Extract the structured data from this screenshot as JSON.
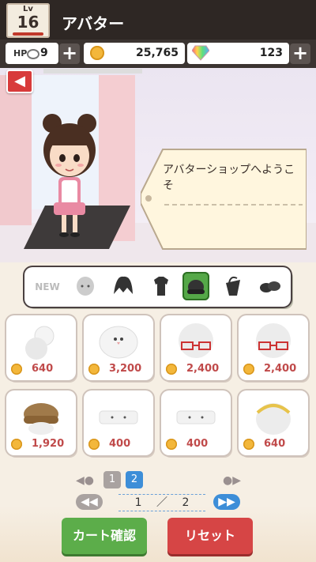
{
  "header": {
    "level_label": "Lv",
    "level": "16",
    "title": "アバター"
  },
  "status": {
    "hp_label": "HP",
    "hp_value": "9",
    "coins": "25,765",
    "gems": "123"
  },
  "stage": {
    "welcome_text": "アバターショップへようこそ"
  },
  "categories": [
    {
      "name": "NEW",
      "selected": false
    },
    {
      "name": "face",
      "selected": false
    },
    {
      "name": "hair",
      "selected": false
    },
    {
      "name": "clothes",
      "selected": false
    },
    {
      "name": "hat",
      "selected": true
    },
    {
      "name": "bag",
      "selected": false
    },
    {
      "name": "shoes",
      "selected": false
    }
  ],
  "items": [
    {
      "price": "640",
      "icon": "chef-hat-icon"
    },
    {
      "price": "3,200",
      "icon": "bird-hat-icon"
    },
    {
      "price": "2,400",
      "icon": "red-glasses-icon"
    },
    {
      "price": "2,400",
      "icon": "red-glasses-icon"
    },
    {
      "price": "1,920",
      "icon": "brown-cap-icon"
    },
    {
      "price": "400",
      "icon": "white-mask-icon"
    },
    {
      "price": "400",
      "icon": "white-mask-icon"
    },
    {
      "price": "640",
      "icon": "gold-headband-icon"
    }
  ],
  "pagination": {
    "page1": "1",
    "page2": "2",
    "current": "1",
    "separator": "／",
    "total": "2"
  },
  "buttons": {
    "cart": "カート確認",
    "reset": "リセット"
  },
  "colors": {
    "accent_green": "#5cad4a",
    "accent_red": "#d64545",
    "price_red": "#c04a4a",
    "page_blue": "#3d8ed8"
  }
}
